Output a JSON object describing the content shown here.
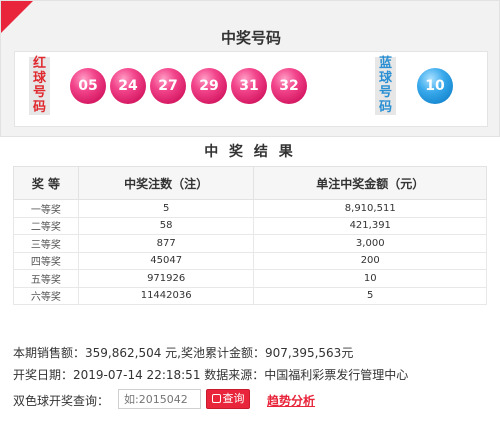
{
  "header": {
    "title": "中奖号码",
    "red_label": [
      "红",
      "球",
      "号",
      "码"
    ],
    "blue_label": [
      "蓝",
      "球",
      "号",
      "码"
    ],
    "red_balls": [
      "05",
      "24",
      "27",
      "29",
      "31",
      "32"
    ],
    "blue_ball": "10"
  },
  "results": {
    "title": "中 奖 结 果",
    "columns": [
      "奖 等",
      "中奖注数（注）",
      "单注中奖金额（元）"
    ],
    "rows": [
      {
        "level": "一等奖",
        "count": "5",
        "amount": "8,910,511"
      },
      {
        "level": "二等奖",
        "count": "58",
        "amount": "421,391"
      },
      {
        "level": "三等奖",
        "count": "877",
        "amount": "3,000"
      },
      {
        "level": "四等奖",
        "count": "45047",
        "amount": "200"
      },
      {
        "level": "五等奖",
        "count": "971926",
        "amount": "10"
      },
      {
        "level": "六等奖",
        "count": "11442036",
        "amount": "5"
      }
    ]
  },
  "info": {
    "sales_line": "本期销售额：359,862,504 元,奖池累计金额：907,395,563元",
    "date_line": "开奖日期：2019-07-14 22:18:51 数据来源：中国福利彩票发行管理中心"
  },
  "query": {
    "label": "双色球开奖查询：",
    "placeholder": "如:2015042",
    "button_label": "查询",
    "trend_link": "趋势分析"
  },
  "colors": {
    "accent_red": "#e8253a",
    "red_ball": "#e02f73",
    "blue_ball": "#2a9ae0"
  }
}
